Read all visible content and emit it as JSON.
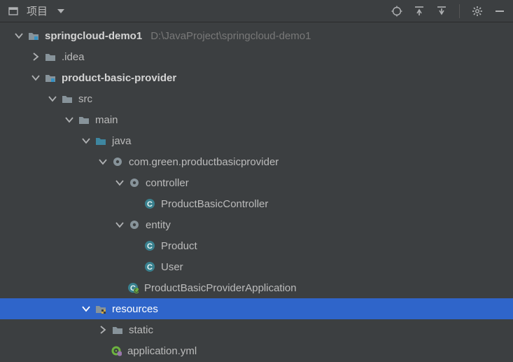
{
  "toolbar": {
    "title": "项目"
  },
  "tree": {
    "root_name": "springcloud-demo1",
    "root_path": "D:\\JavaProject\\springcloud-demo1",
    "idea": ".idea",
    "module": "product-basic-provider",
    "src": "src",
    "main": "main",
    "java": "java",
    "package": "com.green.productbasicprovider",
    "pkg_controller": "controller",
    "cls_controller": "ProductBasicController",
    "pkg_entity": "entity",
    "cls_product": "Product",
    "cls_user": "User",
    "cls_app": "ProductBasicProviderApplication",
    "resources": "resources",
    "static": "static",
    "app_yml": "application.yml"
  }
}
